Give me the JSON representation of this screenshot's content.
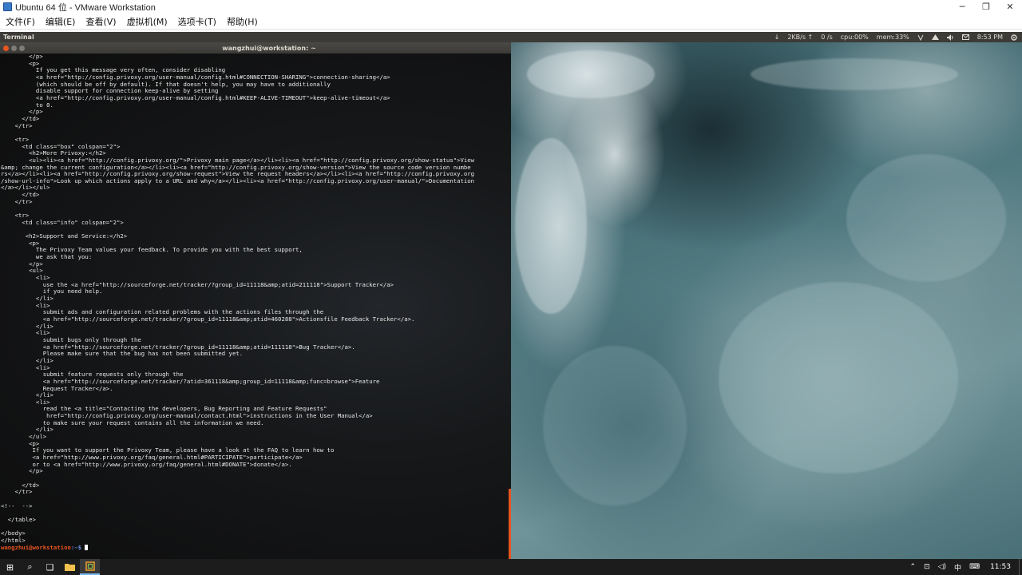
{
  "window": {
    "title": "Ubuntu 64 位 - VMware Workstation",
    "minimize": "─",
    "restore": "❐",
    "close": "✕"
  },
  "menu": [
    "文件(F)",
    "编辑(E)",
    "查看(V)",
    "虚拟机(M)",
    "选项卡(T)",
    "帮助(H)"
  ],
  "ubuntu_panel": {
    "app_name": "Terminal",
    "net_down_icon": "↓",
    "net_rate": "2KB/s ↑",
    "net_up": "0 /s",
    "cpu": "cpu:00%",
    "mem": "mem:33%",
    "time": "8:53 PM"
  },
  "terminal": {
    "title": "wangzhui@workstation: ~",
    "lines": [
      "        </p>",
      "        <p>",
      "          If you get this message very often, consider disabling",
      "          <a href=\"http://config.privoxy.org/user-manual/config.html#CONNECTION-SHARING\">connection-sharing</a>",
      "          (which should be off by default). If that doesn't help, you may have to additionally",
      "          disable support for connection keep-alive by setting",
      "          <a href=\"http://config.privoxy.org/user-manual/config.html#KEEP-ALIVE-TIMEOUT\">keep-alive-timeout</a>",
      "          to 0.",
      "        </p>",
      "      </td>",
      "    </tr>",
      "",
      "    <tr>",
      "      <td class=\"box\" colspan=\"2\">",
      "        <h2>More Privoxy:</h2>",
      "        <ul><li><a href=\"http://config.privoxy.org/\">Privoxy main page</a></li><li><a href=\"http://config.privoxy.org/show-status\">View",
      "&amp; change the current configuration</a></li><li><a href=\"http://config.privoxy.org/show-version\">View the source code version numbe",
      "rs</a></li><li><a href=\"http://config.privoxy.org/show-request\">View the request headers</a></li><li><a href=\"http://config.privoxy.org",
      "/show-url-info\">Look up which actions apply to a URL and why</a></li><li><a href=\"http://config.privoxy.org/user-manual/\">Documentation",
      "</a></li></ul>",
      "      </td>",
      "    </tr>",
      "",
      "    <tr>",
      "      <td class=\"info\" colspan=\"2\">",
      "",
      "       <h2>Support and Service:</h2>",
      "        <p>",
      "          The Privoxy Team values your feedback. To provide you with the best support,",
      "          we ask that you:",
      "        </p>",
      "        <ul>",
      "          <li>",
      "            use the <a href=\"http://sourceforge.net/tracker/?group_id=11118&amp;atid=211118\">Support Tracker</a>",
      "            if you need help.",
      "          </li>",
      "          <li>",
      "            submit ads and configuration related problems with the actions files through the",
      "            <a href=\"http://sourceforge.net/tracker/?group_id=11118&amp;atid=460288\">Actionsfile Feedback Tracker</a>.",
      "          </li>",
      "          <li>",
      "            submit bugs only through the",
      "            <a href=\"http://sourceforge.net/tracker/?group_id=11118&amp;atid=111118\">Bug Tracker</a>.",
      "            Please make sure that the bug has not been submitted yet.",
      "          </li>",
      "          <li>",
      "            submit feature requests only through the",
      "            <a href=\"http://sourceforge.net/tracker/?atid=361118&amp;group_id=11118&amp;func=browse\">Feature",
      "            Request Tracker</a>.",
      "          </li>",
      "          <li>",
      "            read the <a title=\"Contacting the developers, Bug Reporting and Feature Requests\"",
      "             href=\"http://config.privoxy.org/user-manual/contact.html\">instructions in the User Manual</a>",
      "            to make sure your request contains all the information we need.",
      "          </li>",
      "        </ul>",
      "        <p>",
      "         If you want to support the Privoxy Team, please have a look at the FAQ to learn how to",
      "         <a href=\"http://www.privoxy.org/faq/general.html#PARTICIPATE\">participate</a>",
      "         or to <a href=\"http://www.privoxy.org/faq/general.html#DONATE\">donate</a>.",
      "        </p>",
      "",
      "      </td>",
      "    </tr>",
      "",
      "<!--  -->",
      "",
      "  </table>",
      "",
      "</body>",
      "</html>"
    ],
    "prompt_user": "wangzhui@workstation",
    "prompt_path": ":~$ "
  },
  "taskbar": {
    "start_icon": "⊞",
    "search_icon": "⌕",
    "task_view_icon": "❏",
    "explorer_icon": "▬",
    "vmware_icon": "◫",
    "tray_chevron": "⌃",
    "tray_network": "⊡",
    "tray_volume": "◁)",
    "tray_ime": "中",
    "tray_keyboard": "⌨",
    "clock": "11:53"
  }
}
